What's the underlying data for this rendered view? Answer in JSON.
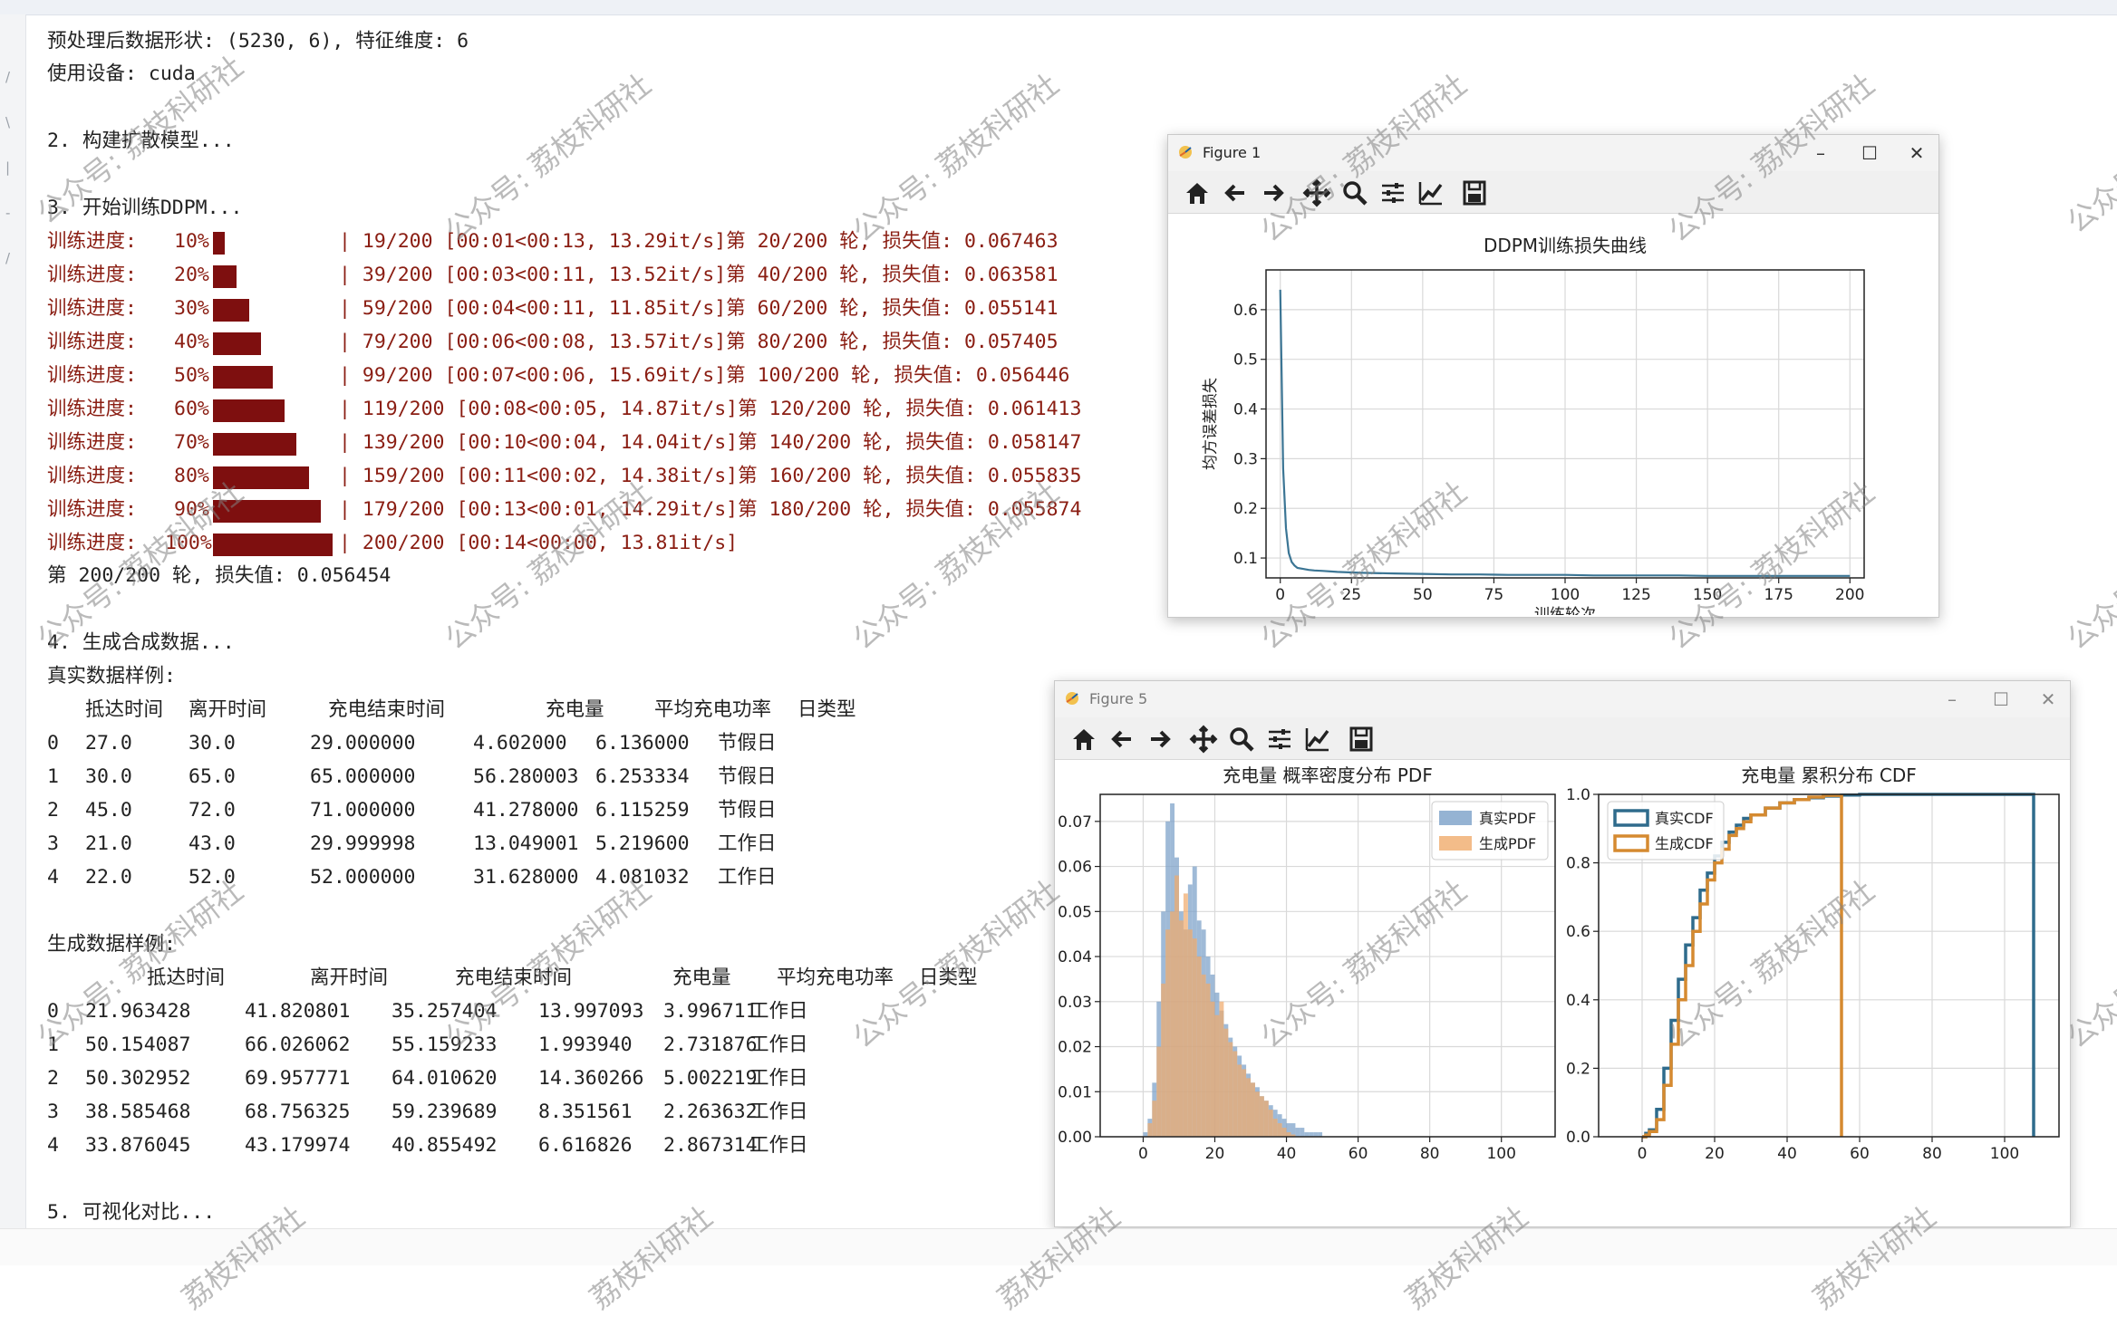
{
  "console": {
    "lines": [
      "预处理后数据形状: (5230, 6), 特征维度: 6",
      "使用设备: cuda",
      "",
      "2. 构建扩散模型...",
      "",
      "3. 开始训练DDPM..."
    ],
    "progress_label": "训练进度:",
    "progress": [
      {
        "pct": "10%|",
        "fill": 0.1,
        "stat": "| 19/200 [00:01<00:13, 13.29it/s]第 20/200 轮, 损失值: 0.067463"
      },
      {
        "pct": "20%|",
        "fill": 0.2,
        "stat": "| 39/200 [00:03<00:11, 13.52it/s]第 40/200 轮, 损失值: 0.063581"
      },
      {
        "pct": "30%|",
        "fill": 0.3,
        "stat": "| 59/200 [00:04<00:11, 11.85it/s]第 60/200 轮, 损失值: 0.055141"
      },
      {
        "pct": "40%|",
        "fill": 0.4,
        "stat": "| 79/200 [00:06<00:08, 13.57it/s]第 80/200 轮, 损失值: 0.057405"
      },
      {
        "pct": "50%|",
        "fill": 0.5,
        "stat": "| 99/200 [00:07<00:06, 15.69it/s]第 100/200 轮, 损失值: 0.056446"
      },
      {
        "pct": "60%|",
        "fill": 0.6,
        "stat": "| 119/200 [00:08<00:05, 14.87it/s]第 120/200 轮, 损失值: 0.061413"
      },
      {
        "pct": "70%|",
        "fill": 0.7,
        "stat": "| 139/200 [00:10<00:04, 14.04it/s]第 140/200 轮, 损失值: 0.058147"
      },
      {
        "pct": "80%|",
        "fill": 0.8,
        "stat": "| 159/200 [00:11<00:02, 14.38it/s]第 160/200 轮, 损失值: 0.055835"
      },
      {
        "pct": "90%|",
        "fill": 0.9,
        "stat": "| 179/200 [00:13<00:01, 14.29it/s]第 180/200 轮, 损失值: 0.055874"
      },
      {
        "pct": "100%|",
        "fill": 1.0,
        "stat": "| 200/200 [00:14<00:00, 13.81it/s]"
      }
    ],
    "final_line": "第 200/200 轮, 损失值: 0.056454",
    "gen_title": "4. 生成合成数据...",
    "real_title": "真实数据样例:",
    "real_headers": [
      "抵达时间",
      "离开时间",
      "充电结束时间",
      "充电量",
      "平均充电功率",
      "日类型"
    ],
    "real_rows": [
      [
        "0",
        "27.0",
        "30.0",
        "29.000000",
        "4.602000",
        "6.136000",
        "节假日"
      ],
      [
        "1",
        "30.0",
        "65.0",
        "65.000000",
        "56.280003",
        "6.253334",
        "节假日"
      ],
      [
        "2",
        "45.0",
        "72.0",
        "71.000000",
        "41.278000",
        "6.115259",
        "节假日"
      ],
      [
        "3",
        "21.0",
        "43.0",
        "29.999998",
        "13.049001",
        "5.219600",
        "工作日"
      ],
      [
        "4",
        "22.0",
        "52.0",
        "52.000000",
        "31.628000",
        "4.081032",
        "工作日"
      ]
    ],
    "synth_title": "生成数据样例:",
    "synth_headers": [
      "抵达时间",
      "离开时间",
      "充电结束时间",
      "充电量",
      "平均充电功率",
      "日类型"
    ],
    "synth_rows": [
      [
        "0",
        "21.963428",
        "41.820801",
        "35.257404",
        "13.997093",
        "3.996711",
        "工作日"
      ],
      [
        "1",
        "50.154087",
        "66.026062",
        "55.159233",
        "1.993940",
        "2.731876",
        "工作日"
      ],
      [
        "2",
        "50.302952",
        "69.957771",
        "64.010620",
        "14.360266",
        "5.002219",
        "工作日"
      ],
      [
        "3",
        "38.585468",
        "68.756325",
        "59.239689",
        "8.351561",
        "2.263632",
        "工作日"
      ],
      [
        "4",
        "33.876045",
        "43.179974",
        "40.855492",
        "6.616826",
        "2.867314",
        "工作日"
      ]
    ],
    "viz_title": "5. 可视化对比..."
  },
  "watermark": "公众号: 荔枝科研社",
  "watermark_tail": "荔枝科研社",
  "gutter_marks": [
    "/",
    "\\",
    "|",
    "-",
    "/"
  ],
  "figure1": {
    "title": "Figure 1",
    "icons": [
      "home-icon",
      "back-icon",
      "forward-icon",
      "pan-icon",
      "zoom-icon",
      "configure-icon",
      "edit-curve-icon",
      "save-icon"
    ]
  },
  "figure5": {
    "title": "Figure 5",
    "icons": [
      "home-icon",
      "back-icon",
      "forward-icon",
      "pan-icon",
      "zoom-icon",
      "configure-icon",
      "edit-curve-icon",
      "save-icon"
    ]
  },
  "colors": {
    "bar": "#7e0f0f",
    "line": "#3b7594",
    "real": "#7aa0c8",
    "gen": "#f0ab6c",
    "real_cdf": "#2f6b8c",
    "gen_cdf": "#d58a30"
  },
  "chart_data": [
    {
      "type": "line",
      "title": "DDPM训练损失曲线",
      "xlabel": "训练轮次",
      "ylabel": "均方误差损失",
      "xlim": [
        -5,
        205
      ],
      "ylim": [
        0.06,
        0.68
      ],
      "xticks": [
        0,
        25,
        50,
        75,
        100,
        125,
        150,
        175,
        200
      ],
      "yticks": [
        0.1,
        0.2,
        0.3,
        0.4,
        0.5,
        0.6
      ],
      "grid": true,
      "series": [
        {
          "x": [
            0,
            1,
            2,
            3,
            4,
            5,
            6,
            8,
            10,
            12,
            15,
            20,
            25,
            30,
            40,
            50,
            60,
            70,
            80,
            90,
            100,
            110,
            120,
            130,
            140,
            150,
            160,
            170,
            180,
            190,
            200
          ],
          "y": [
            0.64,
            0.28,
            0.16,
            0.11,
            0.092,
            0.085,
            0.08,
            0.078,
            0.076,
            0.075,
            0.074,
            0.072,
            0.071,
            0.07,
            0.069,
            0.068,
            0.067,
            0.067,
            0.066,
            0.066,
            0.066,
            0.065,
            0.065,
            0.065,
            0.065,
            0.064,
            0.064,
            0.064,
            0.064,
            0.064,
            0.064
          ]
        }
      ]
    },
    {
      "type": "bar",
      "title": "充电量 概率密度分布 PDF",
      "xlim": [
        -12,
        115
      ],
      "ylim": [
        0,
        0.076
      ],
      "xticks": [
        0,
        20,
        40,
        60,
        80,
        100
      ],
      "yticks": [
        0.0,
        0.01,
        0.02,
        0.03,
        0.04,
        0.05,
        0.06,
        0.07
      ],
      "legend": "top-right",
      "grid": true,
      "bin_start": 0,
      "bin_width": 1.25,
      "series": [
        {
          "name": "真实PDF",
          "values": [
            0.001,
            0.004,
            0.012,
            0.03,
            0.05,
            0.07,
            0.074,
            0.062,
            0.05,
            0.046,
            0.056,
            0.06,
            0.048,
            0.046,
            0.04,
            0.036,
            0.032,
            0.028,
            0.025,
            0.022,
            0.02,
            0.018,
            0.016,
            0.014,
            0.012,
            0.011,
            0.009,
            0.008,
            0.007,
            0.006,
            0.005,
            0.004,
            0.003,
            0.003,
            0.002,
            0.002,
            0.001,
            0.001,
            0.001,
            0.001
          ]
        },
        {
          "name": "生成PDF",
          "values": [
            0.0,
            0.003,
            0.008,
            0.02,
            0.034,
            0.046,
            0.05,
            0.058,
            0.048,
            0.054,
            0.046,
            0.044,
            0.04,
            0.036,
            0.034,
            0.03,
            0.027,
            0.03,
            0.024,
            0.021,
            0.019,
            0.016,
            0.015,
            0.013,
            0.012,
            0.01,
            0.009,
            0.008,
            0.006,
            0.004,
            0.003,
            0.002,
            0.001,
            0.0005,
            0.0,
            0.0,
            0.0,
            0.0,
            0.0,
            0.0
          ]
        }
      ]
    },
    {
      "type": "line",
      "title": "充电量 累积分布 CDF",
      "xlim": [
        -12,
        115
      ],
      "ylim": [
        0,
        1.0
      ],
      "xticks": [
        0,
        20,
        40,
        60,
        80,
        100
      ],
      "yticks": [
        0.0,
        0.2,
        0.4,
        0.6,
        0.8,
        1.0
      ],
      "legend": "top-left",
      "grid": true,
      "series": [
        {
          "name": "真实CDF",
          "x": [
            0,
            1,
            2,
            4,
            6,
            8,
            10,
            12,
            14,
            16,
            18,
            20,
            22,
            24,
            26,
            28,
            30,
            34,
            38,
            42,
            46,
            50,
            55,
            60,
            70,
            80,
            90,
            100,
            108,
            108
          ],
          "y": [
            0,
            0.01,
            0.02,
            0.08,
            0.2,
            0.34,
            0.46,
            0.56,
            0.64,
            0.72,
            0.77,
            0.82,
            0.86,
            0.89,
            0.91,
            0.93,
            0.94,
            0.96,
            0.975,
            0.985,
            0.99,
            0.995,
            0.998,
            1.0,
            1.0,
            1.0,
            1.0,
            1.0,
            1.0,
            0.0
          ]
        },
        {
          "name": "生成CDF",
          "x": [
            0,
            1,
            2,
            4,
            6,
            8,
            10,
            12,
            14,
            16,
            18,
            20,
            22,
            24,
            26,
            28,
            30,
            34,
            38,
            42,
            46,
            50,
            55,
            55
          ],
          "y": [
            0,
            0.005,
            0.015,
            0.05,
            0.15,
            0.27,
            0.4,
            0.5,
            0.6,
            0.68,
            0.75,
            0.8,
            0.84,
            0.88,
            0.9,
            0.92,
            0.94,
            0.96,
            0.975,
            0.985,
            0.992,
            0.997,
            1.0,
            0.0
          ]
        }
      ]
    }
  ]
}
